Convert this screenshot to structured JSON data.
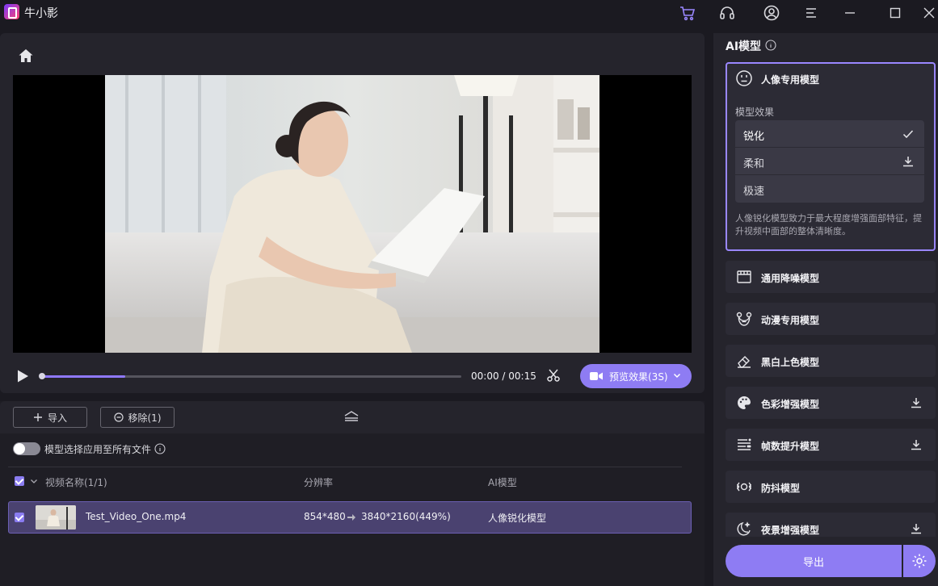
{
  "app": {
    "title": "牛小影"
  },
  "titlebar": {
    "icons": [
      "cart-icon",
      "headset-icon",
      "user-icon",
      "menu-icon",
      "minimize-icon",
      "maximize-icon",
      "close-icon"
    ],
    "accent": "#8e7cf3"
  },
  "player": {
    "time_current": "00:00",
    "time_total": "00:15",
    "time_display": "00:00 / 00:15",
    "progress_fraction": 0.2,
    "preview_label": "预览效果(3S)"
  },
  "files": {
    "import_label": "导入",
    "remove_label": "移除(1)",
    "toggle_label": "模型选择应用至所有文件",
    "columns": {
      "name": "视频名称(1/1)",
      "resolution": "分辨率",
      "model": "AI模型"
    },
    "rows": [
      {
        "name": "Test_Video_One.mp4",
        "res_from": "854*480",
        "res_to": "3840*2160(449%)",
        "model": "人像锐化模型"
      }
    ]
  },
  "panel": {
    "title": "AI模型",
    "active_model": {
      "title": "人像专用模型",
      "effect_label": "模型效果",
      "effects": [
        {
          "label": "锐化",
          "state": "selected"
        },
        {
          "label": "柔和",
          "state": "download"
        },
        {
          "label": "极速",
          "state": ""
        }
      ],
      "description": "人像锐化模型致力于最大程度增强面部特征，提升视频中面部的整体清晰度。"
    },
    "models": [
      {
        "title": "通用降噪模型",
        "icon": "clapperboard-icon",
        "download": false
      },
      {
        "title": "动漫专用模型",
        "icon": "bear-face-icon",
        "download": false
      },
      {
        "title": "黑白上色模型",
        "icon": "eraser-icon",
        "download": false
      },
      {
        "title": "色彩增强模型",
        "icon": "palette-icon",
        "download": true
      },
      {
        "title": "帧数提升模型",
        "icon": "frames-icon",
        "download": true
      },
      {
        "title": "防抖模型",
        "icon": "stabilizer-icon",
        "download": false
      },
      {
        "title": "夜景增强模型",
        "icon": "moon-icon",
        "download": true
      }
    ],
    "export_label": "导出"
  }
}
